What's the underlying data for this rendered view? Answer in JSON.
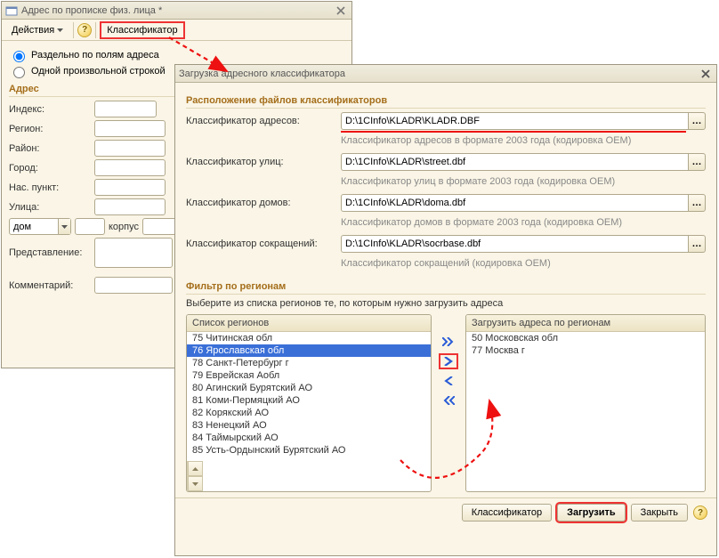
{
  "win1": {
    "title": "Адрес по прописке физ. лица *",
    "toolbar": {
      "actions": "Действия",
      "classifier": "Классификатор"
    },
    "radio": {
      "by_fields": "Раздельно по полям адреса",
      "free_string": "Одной произвольной строкой"
    },
    "section_address": "Адрес",
    "labels": {
      "index": "Индекс:",
      "region": "Регион:",
      "district": "Район:",
      "city": "Город:",
      "locality": "Нас. пункт:",
      "street": "Улица:",
      "house_type": "дом",
      "building_label": "корпус",
      "representation": "Представление:",
      "comment": "Комментарий:"
    }
  },
  "win2": {
    "title": "Загрузка адресного классификатора",
    "section_files": "Расположение файлов классификаторов",
    "files": {
      "addr_label": "Классификатор адресов:",
      "addr_value": "D:\\1CInfo\\KLADR\\KLADR.DBF",
      "addr_hint": "Классификатор адресов в формате  2003 года  (кодировка OEM)",
      "street_label": "Классификатор улиц:",
      "street_value": "D:\\1CInfo\\KLADR\\street.dbf",
      "street_hint": "Классификатор улиц в формате  2003 года  (кодировка OEM)",
      "house_label": "Классификатор домов:",
      "house_value": "D:\\1CInfo\\KLADR\\doma.dbf",
      "house_hint": "Классификатор домов в формате  2003 года  (кодировка OEM)",
      "abbr_label": "Классификатор сокращений:",
      "abbr_value": "D:\\1CInfo\\KLADR\\socrbase.dbf",
      "abbr_hint": "Классификатор сокращений (кодировка OEM)"
    },
    "section_filter": "Фильтр по регионам",
    "filter_hint": "Выберите из списка регионов те, по которым нужно загрузить адреса",
    "list_left_header": "Список регионов",
    "list_right_header": "Загрузить адреса по регионам",
    "regions_left": [
      "75 Читинская обл",
      "76 Ярославская обл",
      "78 Санкт-Петербург г",
      "79 Еврейская Аобл",
      "80 Агинский Бурятский АО",
      "81 Коми-Пермяцкий АО",
      "82 Корякский АО",
      "83 Ненецкий АО",
      "84 Таймырский АО",
      "85 Усть-Ордынский Бурятский АО"
    ],
    "regions_left_selected_index": 1,
    "regions_right": [
      "50 Московская обл",
      "77 Москва г"
    ],
    "footer": {
      "classifier": "Классификатор",
      "load": "Загрузить",
      "close": "Закрыть"
    }
  }
}
